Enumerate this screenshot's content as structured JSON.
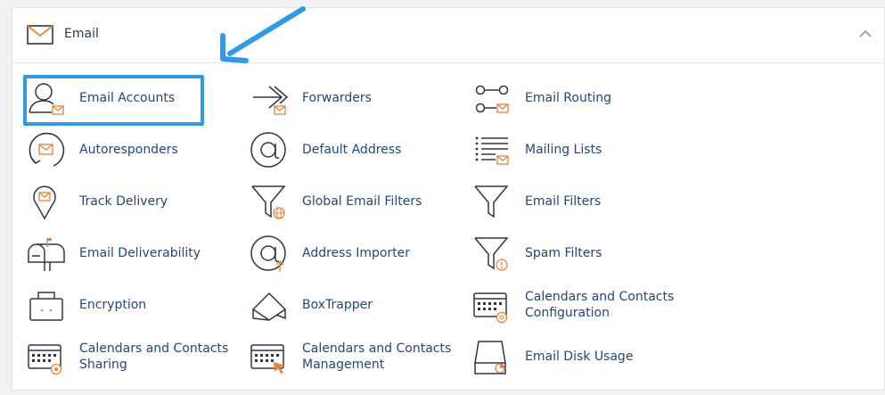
{
  "section": {
    "title": "Email",
    "icon": "envelope-icon",
    "collapse_icon": "chevron-up-icon"
  },
  "colors": {
    "accent_highlight": "#2f9ae8",
    "link_text": "#22477a",
    "icon_stroke": "#2b3641",
    "icon_accent": "#e8833a"
  },
  "items": [
    {
      "label": "Email Accounts",
      "icon": "user-mail-icon",
      "highlighted": true
    },
    {
      "label": "Forwarders",
      "icon": "forward-arrow-icon"
    },
    {
      "label": "Email Routing",
      "icon": "routing-toggle-icon"
    },
    {
      "label": "Autoresponders",
      "icon": "autoresponder-icon"
    },
    {
      "label": "Default Address",
      "icon": "at-sign-icon"
    },
    {
      "label": "Mailing Lists",
      "icon": "list-mail-icon"
    },
    {
      "label": "Track Delivery",
      "icon": "location-pin-icon"
    },
    {
      "label": "Global Email Filters",
      "icon": "filter-globe-icon"
    },
    {
      "label": "Email Filters",
      "icon": "filter-icon"
    },
    {
      "label": "Email Deliverability",
      "icon": "mailbox-icon"
    },
    {
      "label": "Address Importer",
      "icon": "at-import-icon"
    },
    {
      "label": "Spam Filters",
      "icon": "filter-warning-icon"
    },
    {
      "label": "Encryption",
      "icon": "briefcase-icon"
    },
    {
      "label": "BoxTrapper",
      "icon": "boxtrapper-icon"
    },
    {
      "label": "Calendars and Contacts Configuration",
      "icon": "calendar-settings-icon"
    },
    {
      "label": "Calendars and Contacts Sharing",
      "icon": "calendar-share-icon"
    },
    {
      "label": "Calendars and Contacts Management",
      "icon": "calendar-manage-icon"
    },
    {
      "label": "Email Disk Usage",
      "icon": "disk-usage-icon"
    }
  ]
}
